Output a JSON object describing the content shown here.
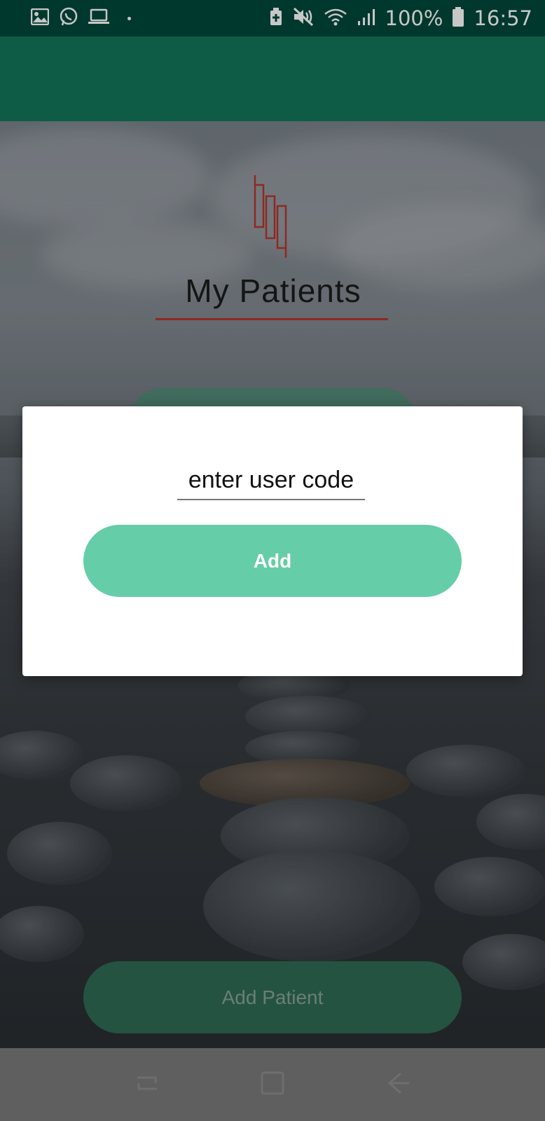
{
  "status_bar": {
    "left_icons": [
      "image-icon",
      "whatsapp-icon",
      "laptop-icon",
      "dot-icon"
    ],
    "right_icons": [
      "battery-saver-icon",
      "mute-icon",
      "wifi-icon",
      "signal-icon",
      "battery-icon"
    ],
    "battery": "100%",
    "time": "16:57"
  },
  "logo": {
    "title": "My Patients"
  },
  "dialog": {
    "input_placeholder": "enter user code",
    "add_label": "Add"
  },
  "main": {
    "add_patient_label": "Add Patient"
  },
  "nav_bar": {
    "buttons": [
      "recent-apps-icon",
      "home-icon",
      "back-icon"
    ]
  },
  "colors": {
    "status_bar": "#00483b",
    "app_bar": "#127759",
    "accent": "#66cda9",
    "logo_accent": "#b5362e",
    "add_patient_bg": "#2f6b54"
  }
}
